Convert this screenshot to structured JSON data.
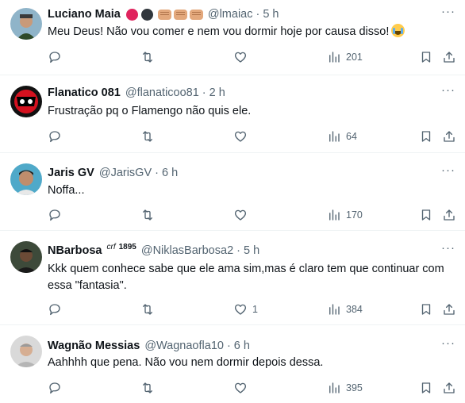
{
  "tweets": [
    {
      "name": "Luciano Maia",
      "handle": "@lmaiac",
      "time": "5 h",
      "text": "Meu Deus! Não vou comer e nem vou dormir hoje por causa disso!",
      "replies": "",
      "retweets": "",
      "likes": "",
      "views": "201",
      "name_emojis": [
        "red-circle",
        "black-circle",
        "fist",
        "fist",
        "fist"
      ],
      "text_emoji": "loudly-crying-face"
    },
    {
      "name": "Flanatico 081",
      "handle": "@flanaticoo81",
      "time": "2 h",
      "text": "Frustração pq o Flamengo não quis ele.",
      "replies": "",
      "retweets": "",
      "likes": "",
      "views": "64"
    },
    {
      "name": "Jaris GV",
      "handle": "@JarisGV",
      "time": "6 h",
      "text": "Noffa...",
      "replies": "",
      "retweets": "",
      "likes": "",
      "views": "170"
    },
    {
      "name": "NBarbosa",
      "name_suffix": "crf",
      "name_suffix_year": "1895",
      "handle": "@NiklasBarbosa2",
      "time": "5 h",
      "text": "Kkk quem conhece sabe que ele ama sim,mas é claro tem que continuar com essa \"fantasia\".",
      "replies": "",
      "retweets": "",
      "likes": "1",
      "views": "384"
    },
    {
      "name": "Wagnão Messias",
      "handle": "@Wagnaofla10",
      "time": "6 h",
      "text": "Aahhhh que pena. Não vou nem dormir depois dessa.",
      "replies": "",
      "retweets": "",
      "likes": "",
      "views": "395"
    }
  ],
  "separator": "·",
  "more_label": "···",
  "colors": {
    "text": "#0f1419",
    "secondary": "#536471",
    "divider": "#eff3f4"
  },
  "icons": [
    "reply-icon",
    "retweet-icon",
    "like-icon",
    "views-icon",
    "bookmark-icon",
    "share-icon"
  ]
}
